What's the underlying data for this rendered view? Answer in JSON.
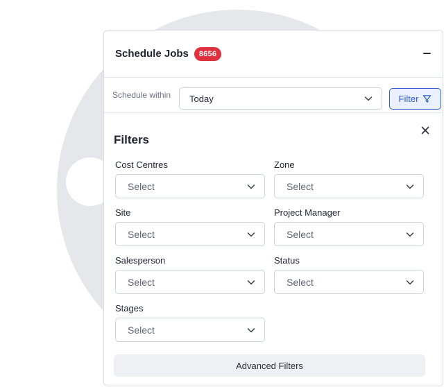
{
  "header": {
    "title": "Schedule Jobs",
    "badge_count": "8656"
  },
  "schedule": {
    "label": "Schedule within",
    "value": "Today",
    "filter_button_label": "Filter"
  },
  "filters": {
    "title": "Filters",
    "fields": {
      "cost_centres": {
        "label": "Cost Centres",
        "value": "Select"
      },
      "zone": {
        "label": "Zone",
        "value": "Select"
      },
      "site": {
        "label": "Site",
        "value": "Select"
      },
      "project_manager": {
        "label": "Project Manager",
        "value": "Select"
      },
      "salesperson": {
        "label": "Salesperson",
        "value": "Select"
      },
      "status": {
        "label": "Status",
        "value": "Select"
      },
      "stages": {
        "label": "Stages",
        "value": "Select"
      }
    },
    "advanced_label": "Advanced Filters"
  },
  "colors": {
    "badge": "#e0303d",
    "accent": "#2d5bd8",
    "accent_bg": "#eaf0fd",
    "backdrop": "#e5e7ea"
  },
  "icons": {
    "minimize": "minus-icon",
    "dropdown": "chevron-down-icon",
    "filter": "funnel-icon",
    "close": "close-icon"
  }
}
